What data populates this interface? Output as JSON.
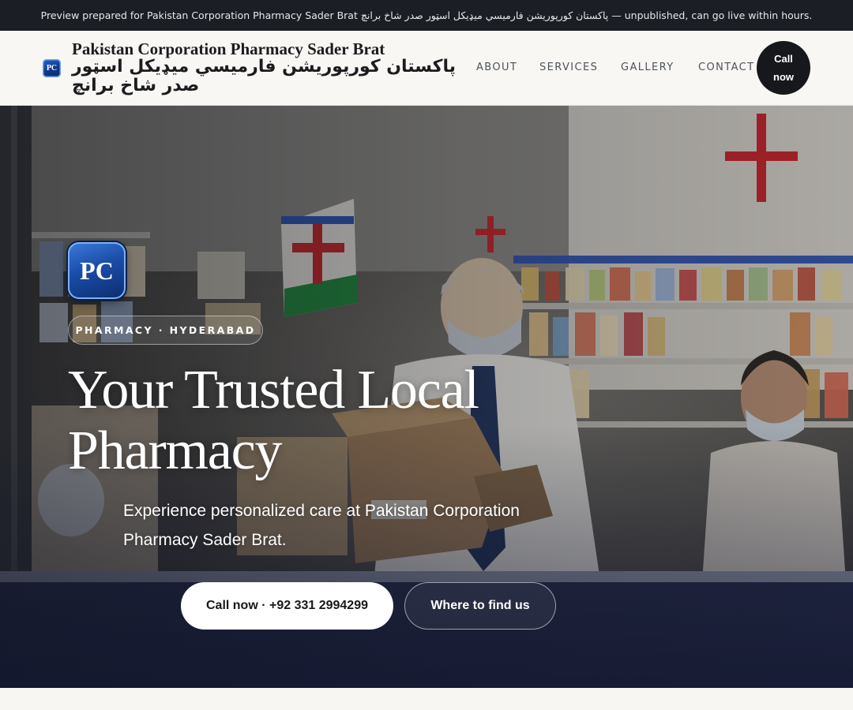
{
  "banner": {
    "text": "Preview prepared for Pakistan Corporation Pharmacy Sader Brat پاکستان کورپوریشن فارمیسي میډیکل اسټور صدر شاخ برانچ — unpublished, can go live within hours."
  },
  "header": {
    "logo_initials": "PC",
    "brand_name_en": "Pakistan Corporation Pharmacy Sader Brat",
    "brand_name_ur": "پاکستان کورپوریشن فارمیسي میډیکل اسټور صدر شاخ برانچ",
    "nav": [
      "ABOUT",
      "SERVICES",
      "GALLERY",
      "CONTACT"
    ],
    "call_label_line1": "Call",
    "call_label_line2": "now"
  },
  "hero": {
    "logo_initials": "PC",
    "tag": "PHARMACY · HYDERABAD",
    "headline": "Your Trusted Local Pharmacy",
    "lede": "Experience personalized care at Pakistan Corporation Pharmacy Sader Brat.",
    "primary_cta": "Call now · +92 331 2994299",
    "secondary_cta": "Where to find us",
    "image_description_icon": "pharmacy-photo"
  },
  "colors": {
    "banner_bg": "#1b1e24",
    "header_bg": "#f8f7f4",
    "call_button_bg": "#17181b",
    "logo_blue": "#1a4ca8",
    "cross_red": "#c9242b"
  }
}
